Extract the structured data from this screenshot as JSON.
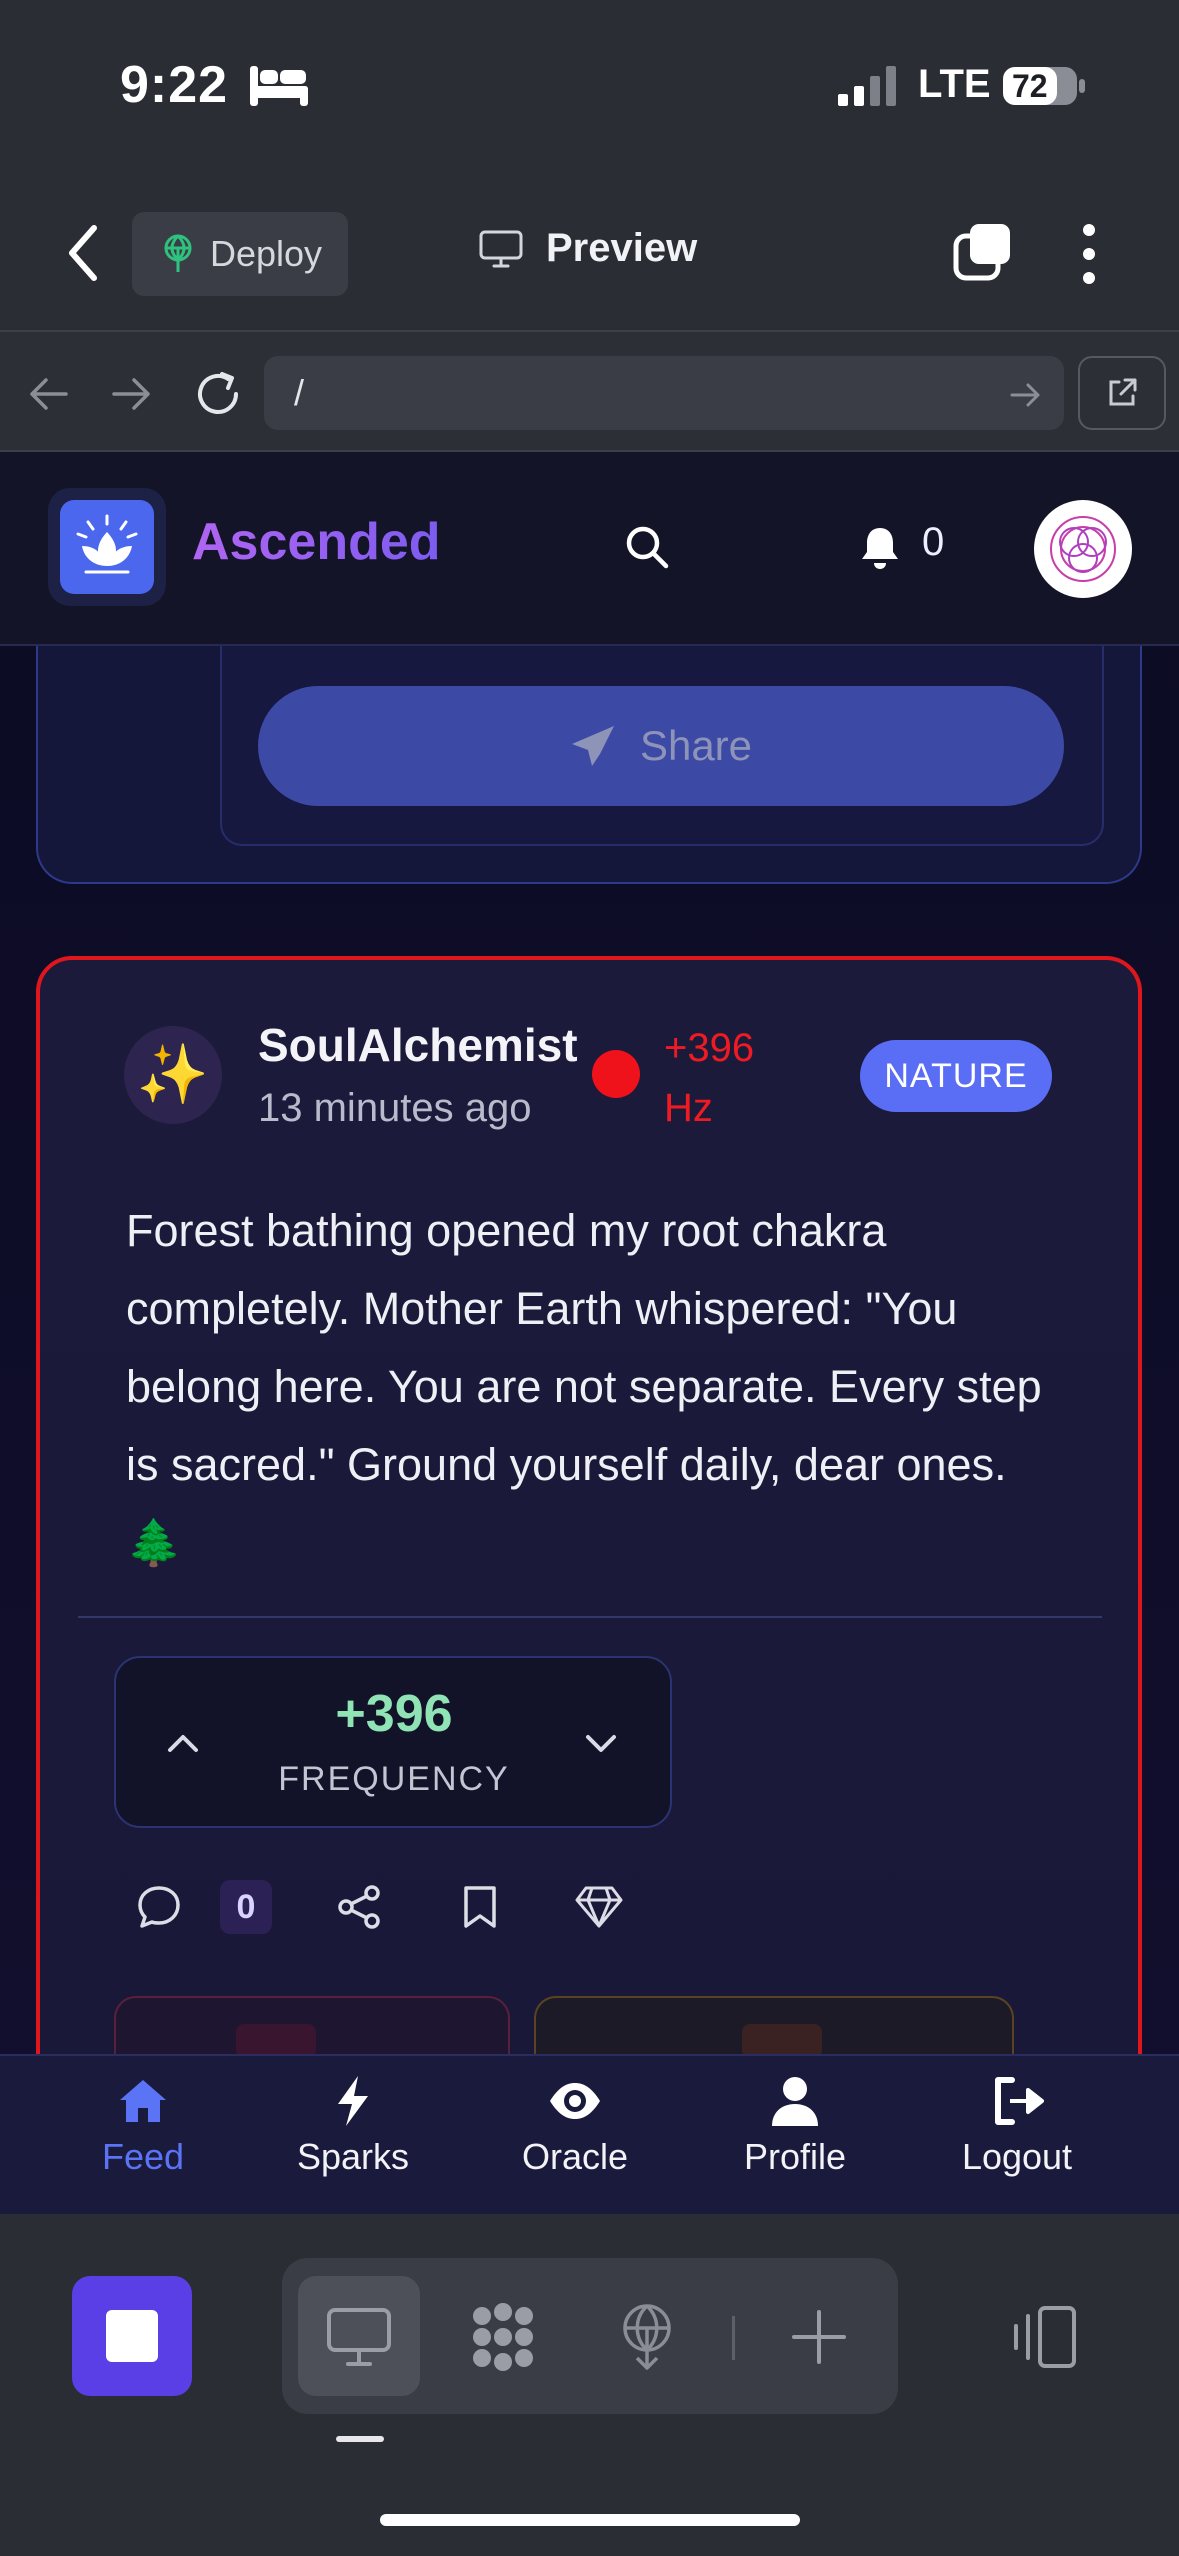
{
  "status_bar": {
    "time": "9:22",
    "network": "LTE",
    "battery": "72"
  },
  "ide_header": {
    "deploy_label": "Deploy",
    "preview_label": "Preview"
  },
  "browser": {
    "url": "/"
  },
  "app": {
    "brand": "Ascended",
    "notification_count": "0",
    "prev_post": {
      "share_label": "Share"
    },
    "post": {
      "author": "SoulAlchemist",
      "time_ago": "13 minutes ago",
      "frequency": "+396 Hz",
      "tag": "NATURE",
      "avatar_emoji": "✨",
      "body": "Forest bathing opened my root chakra completely. Mother Earth whispered: \"You belong here. You are not separate. Every step is sacred.\" Ground yourself daily, dear ones. 🌲",
      "vote_value": "+396",
      "vote_label": "FREQUENCY",
      "comment_count": "0"
    },
    "bottom_nav": [
      {
        "label": "Feed",
        "icon": "home-icon",
        "active": true
      },
      {
        "label": "Sparks",
        "icon": "bolt-icon"
      },
      {
        "label": "Oracle",
        "icon": "eye-icon"
      },
      {
        "label": "Profile",
        "icon": "user-icon"
      },
      {
        "label": "Logout",
        "icon": "logout-icon"
      }
    ]
  },
  "colors": {
    "accent": "#5b74f6",
    "brand_gradient_start": "#b065f2",
    "highlight_border": "#e0161d",
    "frequency_red": "#ef1b22",
    "vote_green": "#8fe3b5",
    "tag_blue": "#5a6ef5",
    "stop_purple": "#5a3ee6"
  }
}
